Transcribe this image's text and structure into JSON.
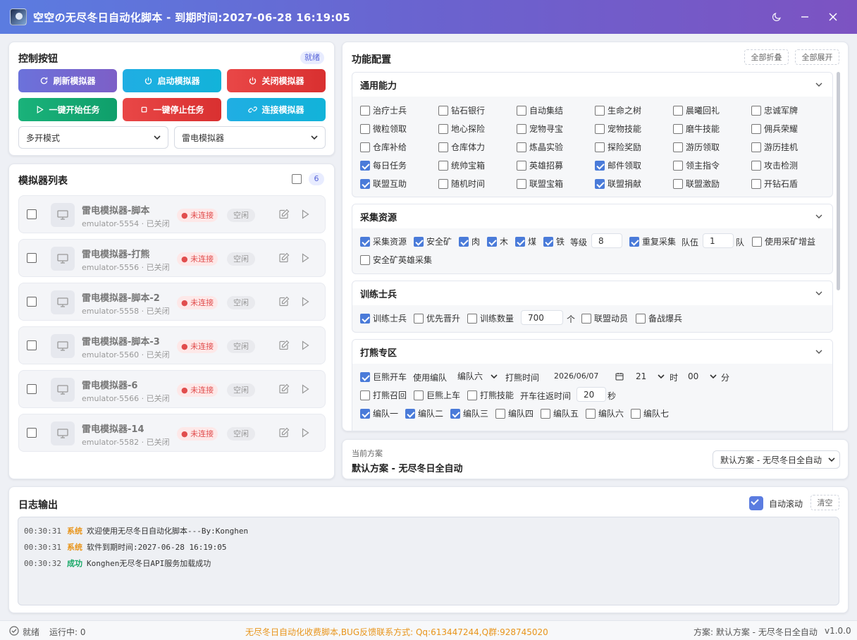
{
  "window": {
    "title": "空空の无尽冬日自动化脚本 - 到期时间:2027-06-28 16:19:05"
  },
  "control": {
    "title": "控制按钮",
    "status_badge": "就绪",
    "buttons": {
      "refresh": "刷新模拟器",
      "start_emu": "启动模拟器",
      "close_emu": "关闭模拟器",
      "start_task": "一键开始任务",
      "stop_task": "一键停止任务",
      "connect": "连接模拟器"
    },
    "mode_select": "多开模式",
    "emu_type_select": "雷电模拟器"
  },
  "emulators": {
    "title": "模拟器列表",
    "count": "6",
    "items": [
      {
        "name": "雷电模拟器-脚本",
        "sub": "emulator-5554 · 已关闭",
        "status": "未连接",
        "state": "空闲"
      },
      {
        "name": "雷电模拟器-打熊",
        "sub": "emulator-5556 · 已关闭",
        "status": "未连接",
        "state": "空闲"
      },
      {
        "name": "雷电模拟器-脚本-2",
        "sub": "emulator-5558 · 已关闭",
        "status": "未连接",
        "state": "空闲"
      },
      {
        "name": "雷电模拟器-脚本-3",
        "sub": "emulator-5560 · 已关闭",
        "status": "未连接",
        "state": "空闲"
      },
      {
        "name": "雷电模拟器-6",
        "sub": "emulator-5566 · 已关闭",
        "status": "未连接",
        "state": "空闲"
      },
      {
        "name": "雷电模拟器-14",
        "sub": "emulator-5582 · 已关闭",
        "status": "未连接",
        "state": "空闲"
      }
    ]
  },
  "config": {
    "title": "功能配置",
    "collapse_all": "全部折叠",
    "expand_all": "全部展开",
    "general": {
      "title": "通用能力",
      "rows": [
        [
          {
            "label": "治疗士兵",
            "checked": false
          },
          {
            "label": "钻石银行",
            "checked": false
          },
          {
            "label": "自动集结",
            "checked": false
          },
          {
            "label": "生命之树",
            "checked": false
          },
          {
            "label": "晨曦回礼",
            "checked": false
          },
          {
            "label": "忠诚军牌",
            "checked": false
          }
        ],
        [
          {
            "label": "微粒领取",
            "checked": false
          },
          {
            "label": "地心探险",
            "checked": false
          },
          {
            "label": "宠物寻宝",
            "checked": false
          },
          {
            "label": "宠物技能",
            "checked": false
          },
          {
            "label": "磨牛技能",
            "checked": false
          },
          {
            "label": "佣兵荣耀",
            "checked": false
          }
        ],
        [
          {
            "label": "仓库补给",
            "checked": false
          },
          {
            "label": "仓库体力",
            "checked": false
          },
          {
            "label": "炼晶实验",
            "checked": false
          },
          {
            "label": "探险奖励",
            "checked": false
          },
          {
            "label": "游历领取",
            "checked": false
          },
          {
            "label": "游历挂机",
            "checked": false
          }
        ],
        [
          {
            "label": "每日任务",
            "checked": true
          },
          {
            "label": "统帅宝箱",
            "checked": false
          },
          {
            "label": "英雄招募",
            "checked": false
          },
          {
            "label": "邮件领取",
            "checked": true
          },
          {
            "label": "领主指令",
            "checked": false
          },
          {
            "label": "攻击检测",
            "checked": false
          }
        ],
        [
          {
            "label": "联盟互助",
            "checked": true
          },
          {
            "label": "随机时间",
            "checked": false
          },
          {
            "label": "联盟宝箱",
            "checked": false
          },
          {
            "label": "联盟捐献",
            "checked": true
          },
          {
            "label": "联盟激励",
            "checked": false
          },
          {
            "label": "开钻石盾",
            "checked": false
          }
        ]
      ]
    },
    "gather": {
      "title": "采集资源",
      "gather_res": "采集资源",
      "safe_mine": "安全矿",
      "meat": "肉",
      "wood": "木",
      "coal": "煤",
      "iron": "铁",
      "level_label": "等级",
      "level_value": "8",
      "repeat": "重复采集",
      "team_label": "队伍",
      "team_value": "1",
      "team_unit": "队",
      "boost": "使用采矿增益",
      "safe_hero": "安全矿英雄采集"
    },
    "train": {
      "title": "训练士兵",
      "train": "训练士兵",
      "promote": "优先晋升",
      "count_label": "训练数量",
      "count_value": "700",
      "count_unit": "个",
      "alliance_mob": "联盟动员",
      "war_prep": "备战爆兵"
    },
    "bear": {
      "title": "打熊专区",
      "giant_bear": "巨熊开车",
      "use_team_label": "使用编队",
      "team_select": "编队六",
      "bear_time_label": "打熊时间",
      "date_value": "2026/06/07",
      "hour_value": "21",
      "hour_unit": "时",
      "minute_value": "00",
      "minute_unit": "分",
      "bear_recall": "打熊召回",
      "giant_board": "巨熊上车",
      "bear_skill": "打熊技能",
      "roundtrip_label": "开车往返时间",
      "roundtrip_value": "20",
      "roundtrip_unit": "秒",
      "teams": [
        {
          "label": "编队一",
          "checked": true
        },
        {
          "label": "编队二",
          "checked": true
        },
        {
          "label": "编队三",
          "checked": true
        },
        {
          "label": "编队四",
          "checked": false
        },
        {
          "label": "编队五",
          "checked": false
        },
        {
          "label": "编队六",
          "checked": false
        },
        {
          "label": "编队七",
          "checked": false
        }
      ]
    }
  },
  "scheme": {
    "label": "当前方案",
    "name": "默认方案 - 无尽冬日全自动",
    "select": "默认方案 - 无尽冬日全自动"
  },
  "log": {
    "title": "日志输出",
    "auto_scroll": "自动滚动",
    "clear": "清空",
    "lines": [
      {
        "time": "00:30:31",
        "tag": "系统",
        "msg": "欢迎使用无尽冬日自动化脚本---By:Konghen"
      },
      {
        "time": "00:30:31",
        "tag": "系统",
        "msg": "软件到期时间:2027-06-28 16:19:05"
      },
      {
        "time": "00:30:32",
        "tag": "成功",
        "msg": "Konghen无尽冬日API服务加载成功"
      }
    ]
  },
  "statusbar": {
    "state": "就绪",
    "running": "运行中: 0",
    "center": "无尽冬日自动化收费脚本,BUG反馈联系方式: Qq:613447244,Q群:928745020",
    "scheme": "方案: 默认方案 - 无尽冬日全自动",
    "version": "v1.0.0"
  },
  "colors": {
    "accent": "#5b7ce0",
    "system_tag": "#e8941a",
    "success_tag": "#16a866",
    "danger": "#e14d4d",
    "notice": "#e8941a"
  }
}
